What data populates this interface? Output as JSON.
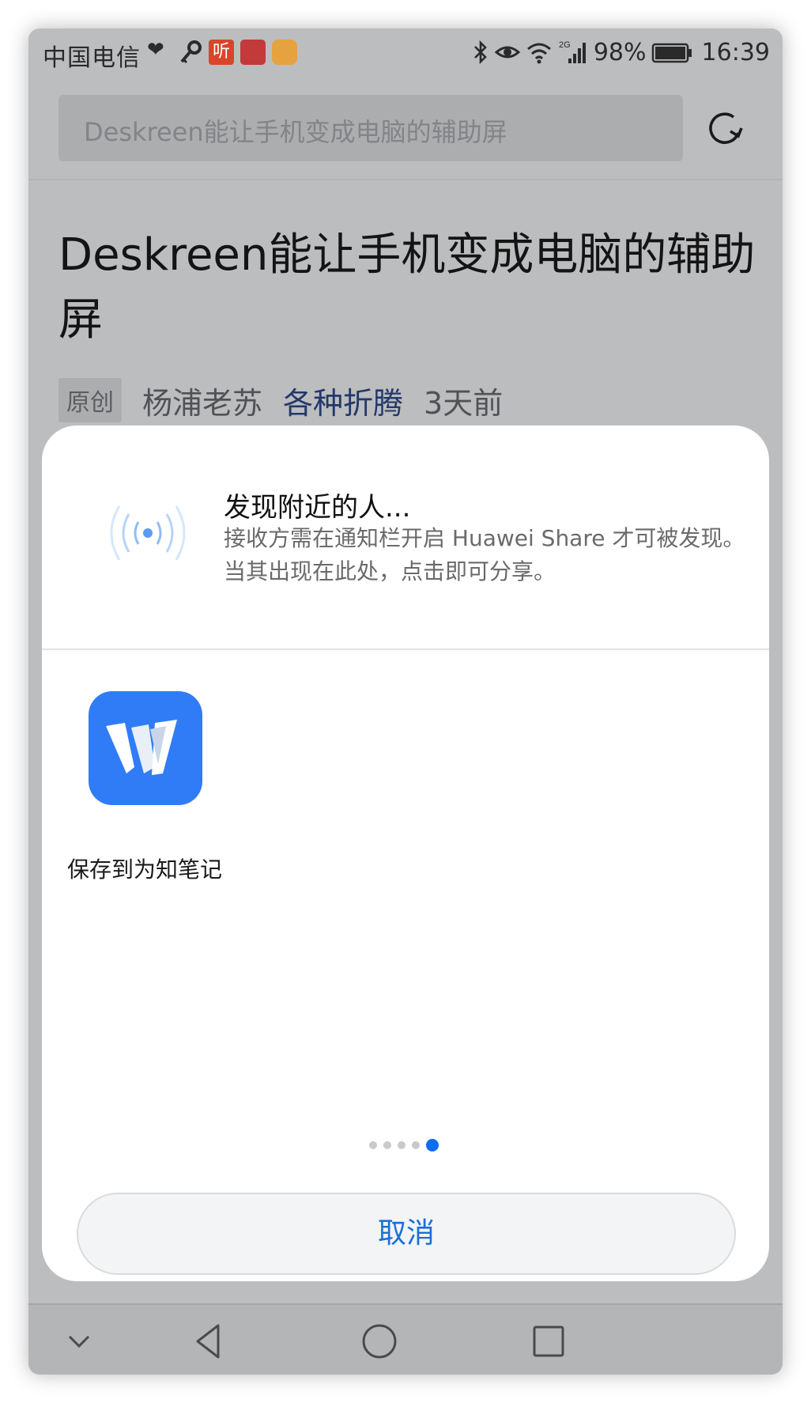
{
  "status_bar": {
    "carrier": "中国电信",
    "network": "2G",
    "battery": "98%",
    "time": "16:39",
    "notification_icons": [
      "heart-icon",
      "key-icon",
      "ting-app-icon",
      "app-icon",
      "cup-icon"
    ],
    "ting_label": "听"
  },
  "header": {
    "search_text": "Deskreen能让手机变成电脑的辅助屏",
    "refresh_icon": "refresh-icon"
  },
  "article": {
    "title": "Deskreen能让手机变成电脑的辅助屏",
    "badge": "原创",
    "author": "杨浦老苏",
    "column": "各种折腾",
    "time_ago": "3天前"
  },
  "share_sheet": {
    "nearby_title": "发现附近的人...",
    "nearby_desc": "接收方需在通知栏开启 Huawei Share 才可被发现。当其出现在此处，点击即可分享。",
    "apps": [
      {
        "label": "保存到为知笔记",
        "icon": "wiz-note-icon",
        "icon_color": "#2f7cf6"
      }
    ],
    "page_count": 5,
    "current_page": 5,
    "cancel_label": "取消",
    "accent_color": "#0b6ef0"
  },
  "nav_bar": {
    "buttons": [
      "collapse-icon",
      "back-icon",
      "home-icon",
      "recents-icon"
    ]
  }
}
